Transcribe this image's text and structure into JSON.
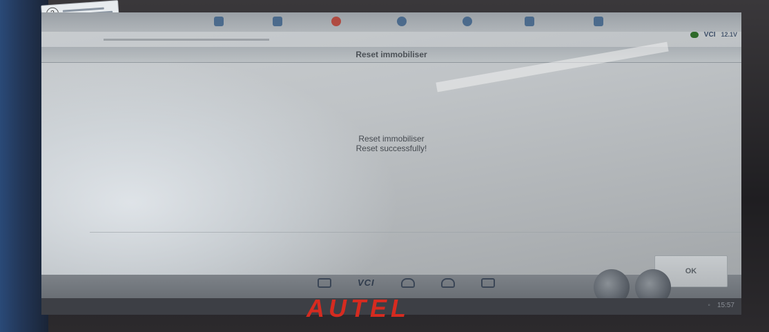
{
  "device": {
    "brand": "AUTEL",
    "sticker_number": "2"
  },
  "toolbar": {
    "icons": [
      "home-icon",
      "fix-icon",
      "settings-icon",
      "car-icon",
      "help-icon",
      "save-icon",
      "print-icon"
    ]
  },
  "status": {
    "vci_label": "VCI",
    "battery_text": "12.1V"
  },
  "page": {
    "title": "Reset immobiliser"
  },
  "message": {
    "line1": "Reset immobiliser",
    "line2": "Reset successfully!"
  },
  "buttons": {
    "ok_label": "OK"
  },
  "navbar": {
    "vci_label": "VCI"
  },
  "sysbar": {
    "clock": "15:57"
  },
  "colors": {
    "brand_red": "#d62b20",
    "screen_bg": "#bfc3c6",
    "toolbar_blue": "#3c5f86"
  }
}
